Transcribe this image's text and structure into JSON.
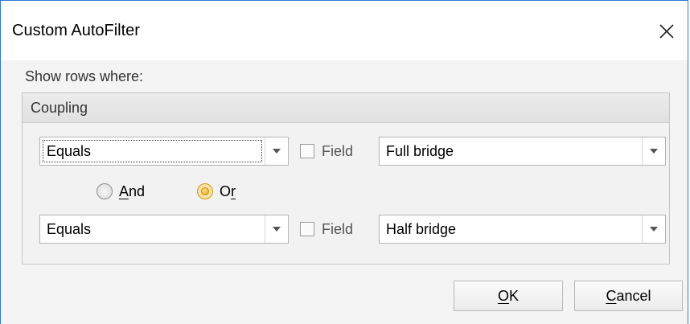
{
  "window": {
    "title": "Custom AutoFilter",
    "close_icon": "close-icon"
  },
  "filter": {
    "show_rows_label": "Show rows where:",
    "column_name": "Coupling",
    "condition1": {
      "operator": "Equals",
      "field_checkbox_label": "Field",
      "field_checked": false,
      "value": "Full bridge"
    },
    "logic": {
      "and_label_underlined": "A",
      "and_label_rest": "nd",
      "or_label_main": "O",
      "or_label_underlined": "r",
      "selected": "Or"
    },
    "condition2": {
      "operator": "Equals",
      "field_checkbox_label": "Field",
      "field_checked": false,
      "value": "Half bridge"
    }
  },
  "buttons": {
    "ok_underlined": "O",
    "ok_rest": "K",
    "cancel_underlined": "C",
    "cancel_rest": "ancel"
  },
  "colors": {
    "window_border": "#2b79d1",
    "radio_selected": "#e8a317"
  }
}
